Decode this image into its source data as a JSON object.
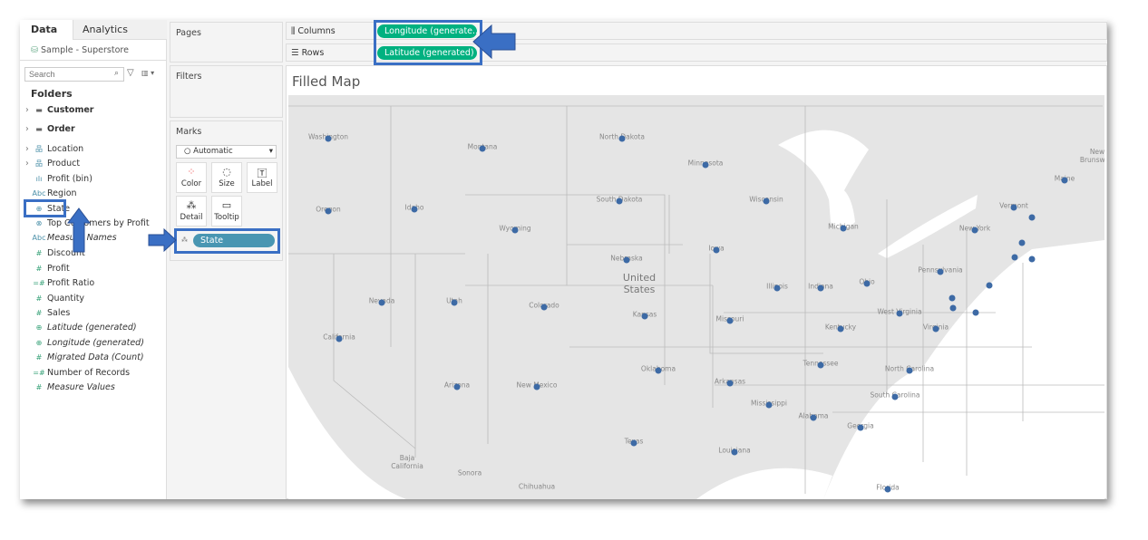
{
  "sidebar": {
    "tabs": [
      "Data",
      "Analytics"
    ],
    "datasource": "Sample - Superstore",
    "search_placeholder": "Search",
    "folders_heading": "Folders",
    "fields": [
      {
        "label": "Customer",
        "icon": "folder-icon",
        "bold": true
      },
      {
        "label": "Order",
        "icon": "folder-icon",
        "bold": true
      },
      {
        "label": "Location",
        "icon": "hierarchy-icon"
      },
      {
        "label": "Product",
        "icon": "hierarchy-icon"
      },
      {
        "label": "Profit (bin)",
        "icon": "bin-icon"
      },
      {
        "label": "Region",
        "icon": "abc-icon"
      },
      {
        "label": "State",
        "icon": "globe-icon"
      },
      {
        "label": "Top Customers by Profit",
        "icon": "set-icon"
      },
      {
        "label": "Measure Names",
        "icon": "abc-icon",
        "italic": true
      },
      {
        "label": "Discount",
        "icon": "hash-icon"
      },
      {
        "label": "Profit",
        "icon": "hash-icon"
      },
      {
        "label": "Profit Ratio",
        "icon": "calc-hash-icon"
      },
      {
        "label": "Quantity",
        "icon": "hash-icon"
      },
      {
        "label": "Sales",
        "icon": "hash-icon"
      },
      {
        "label": "Latitude (generated)",
        "icon": "globe-icon",
        "italic": true
      },
      {
        "label": "Longitude (generated)",
        "icon": "globe-icon",
        "italic": true
      },
      {
        "label": "Migrated Data (Count)",
        "icon": "hash-icon",
        "italic": true
      },
      {
        "label": "Number of Records",
        "icon": "calc-hash-icon"
      },
      {
        "label": "Measure Values",
        "icon": "hash-icon",
        "italic": true
      }
    ]
  },
  "cards": {
    "pages": "Pages",
    "filters": "Filters",
    "marks": "Marks",
    "mark_type": "Automatic",
    "mark_buttons": [
      "Color",
      "Size",
      "Label",
      "Detail",
      "Tooltip"
    ],
    "detail_pill": "State"
  },
  "shelves": {
    "columns_label": "Columns",
    "rows_label": "Rows",
    "columns_pill": "Longitude (generate..",
    "rows_pill": "Latitude (generated)"
  },
  "sheet": {
    "title": "Filled Map"
  },
  "colors": {
    "pill_measure": "#00b180",
    "pill_dimension": "#4996b2",
    "highlight": "#3a6fc4",
    "mark": "#3d6aa5"
  },
  "map": {
    "country_label": "United States",
    "other_labels": [
      "Baja California",
      "Sonora",
      "Chihuahua",
      "New Brunswick"
    ],
    "states": [
      "Washington",
      "Montana",
      "North Dakota",
      "Oregon",
      "Idaho",
      "South Dakota",
      "Wyoming",
      "Nebraska",
      "Nevada",
      "Utah",
      "Colorado",
      "Kansas",
      "California",
      "Oklahoma",
      "Arizona",
      "New Mexico",
      "Texas",
      "Minnesota",
      "Wisconsin",
      "Michigan",
      "Iowa",
      "New York",
      "Vermont",
      "",
      "Maine",
      "",
      "",
      "",
      "Pennsylvania",
      "Illinois",
      "Indiana",
      "Ohio",
      "",
      "",
      "",
      "",
      "West Virginia",
      "Missouri",
      "Kentucky",
      "Virginia",
      "Tennessee",
      "North Carolina",
      "Arkansas",
      "South Carolina",
      "Mississippi",
      "Alabama",
      "Georgia",
      "Louisiana",
      "Florida"
    ]
  }
}
